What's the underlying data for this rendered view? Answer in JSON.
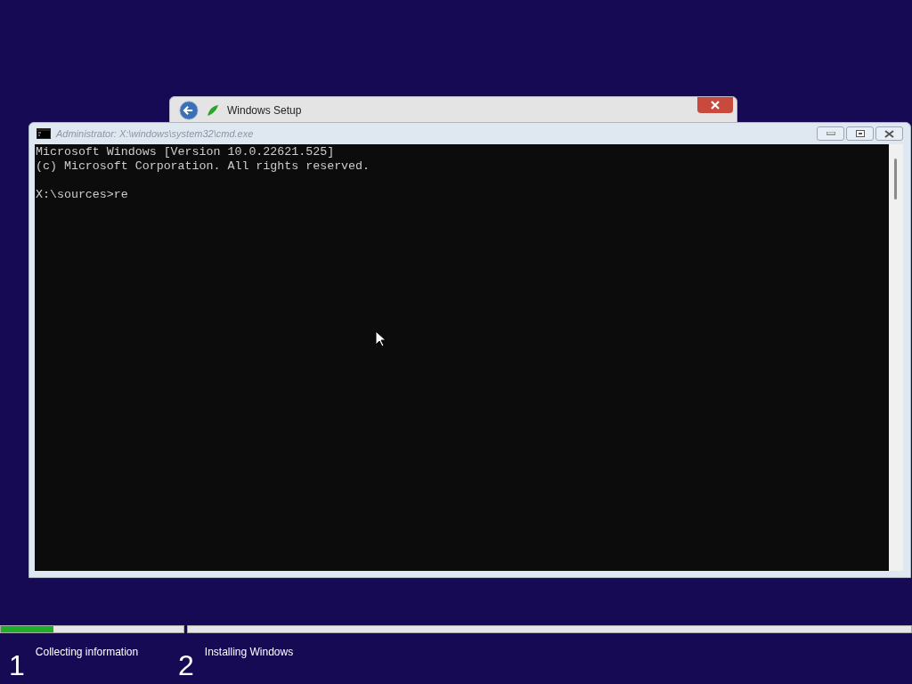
{
  "setup_window": {
    "title": "Windows Setup"
  },
  "cmd_window": {
    "title": "Administrator: X:\\windows\\system32\\cmd.exe",
    "paragraphs": [
      [
        "Microsoft Windows [Version 10.0.22621.525]",
        "(c) Microsoft Corporation. All rights reserved."
      ],
      [
        "X:\\sources>re"
      ]
    ]
  },
  "steps": [
    {
      "number": "1",
      "label": "Collecting information",
      "level": 0.29
    },
    {
      "number": "2",
      "label": "Installing Windows",
      "level": 0
    }
  ]
}
